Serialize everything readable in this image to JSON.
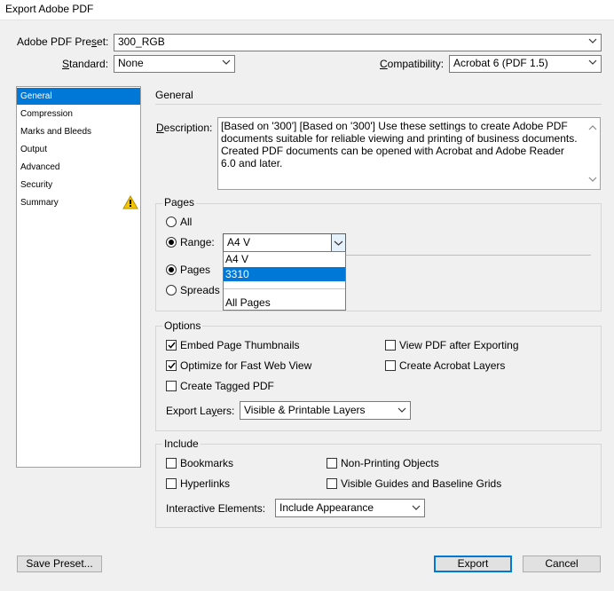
{
  "window": {
    "title": "Export Adobe PDF"
  },
  "preset": {
    "label": "Adobe PDF Preset:",
    "value": "300_RGB"
  },
  "standard": {
    "label": "Standard:",
    "value": "None"
  },
  "compatibility": {
    "label": "Compatibility:",
    "value": "Acrobat 6 (PDF 1.5)"
  },
  "sidebar": {
    "items": [
      {
        "label": "General",
        "selected": true
      },
      {
        "label": "Compression"
      },
      {
        "label": "Marks and Bleeds"
      },
      {
        "label": "Output"
      },
      {
        "label": "Advanced"
      },
      {
        "label": "Security"
      },
      {
        "label": "Summary",
        "warning": true
      }
    ]
  },
  "section_title": "General",
  "description": {
    "label": "Description:",
    "text": "[Based on '300'] [Based on '300'] Use these settings to create Adobe PDF documents suitable for reliable viewing and printing of business documents.  Created PDF documents can be opened with Acrobat and Adobe Reader 6.0 and later."
  },
  "pages": {
    "group_label": "Pages",
    "all_label": "All",
    "range_label": "Range:",
    "range_value": "A4 V",
    "range_options": [
      "A4 V",
      "3310",
      "",
      "All Pages"
    ],
    "range_highlighted": "3310",
    "pages_label": "Pages",
    "spreads_label": "Spreads",
    "selected_scope": "Range",
    "selected_mode": "Pages"
  },
  "options": {
    "group_label": "Options",
    "embed_thumbnails": {
      "label": "Embed Page Thumbnails",
      "checked": true
    },
    "optimize_web": {
      "label": "Optimize for Fast Web View",
      "checked": true
    },
    "tagged_pdf": {
      "label": "Create Tagged PDF",
      "checked": false
    },
    "view_after": {
      "label": "View PDF after Exporting",
      "checked": false
    },
    "acrobat_layers": {
      "label": "Create Acrobat Layers",
      "checked": false
    },
    "export_layers": {
      "label": "Export Layers:",
      "value": "Visible & Printable Layers"
    }
  },
  "include": {
    "group_label": "Include",
    "bookmarks": {
      "label": "Bookmarks",
      "checked": false
    },
    "hyperlinks": {
      "label": "Hyperlinks",
      "checked": false
    },
    "non_printing": {
      "label": "Non-Printing Objects",
      "checked": false
    },
    "guides": {
      "label": "Visible Guides and Baseline Grids",
      "checked": false
    },
    "interactive": {
      "label": "Interactive Elements:",
      "value": "Include Appearance"
    }
  },
  "buttons": {
    "save_preset": "Save Preset...",
    "export": "Export",
    "cancel": "Cancel"
  },
  "colors": {
    "accent": "#0078d7",
    "background": "#f0f0f0",
    "warning": "#f2c500"
  }
}
